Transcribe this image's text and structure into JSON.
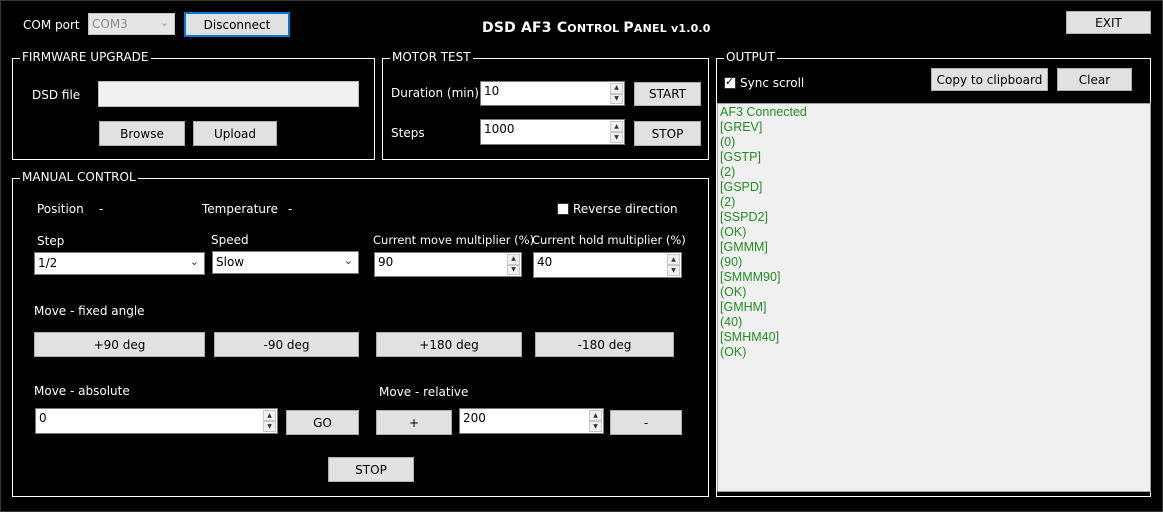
{
  "window": {
    "title_parts": [
      "DSD ",
      "AF3 C",
      "ONTROL ",
      "P",
      "ANEL ",
      "v1.0.0"
    ],
    "title": "DSD AF3 Control Panel v1.0.0",
    "exit_label": "EXIT"
  },
  "com": {
    "label": "COM port",
    "selected": "COM3",
    "disconnect_label": "Disconnect"
  },
  "firmware": {
    "legend": "FIRMWARE UPGRADE",
    "file_label": "DSD file",
    "file_value": "",
    "browse_label": "Browse",
    "upload_label": "Upload"
  },
  "motor_test": {
    "legend": "MOTOR TEST",
    "duration_label": "Duration (min)",
    "duration_value": "10",
    "steps_label": "Steps",
    "steps_value": "1000",
    "start_label": "START",
    "stop_label": "STOP"
  },
  "manual": {
    "legend": "MANUAL CONTROL",
    "position_label": "Position",
    "position_value": "-",
    "temperature_label": "Temperature",
    "temperature_value": "-",
    "reverse_label": "Reverse direction",
    "reverse_checked": false,
    "step_label": "Step",
    "step_value": "1/2",
    "speed_label": "Speed",
    "speed_value": "Slow",
    "move_mult_label": "Current move multiplier (%)",
    "move_mult_value": "90",
    "hold_mult_label": "Current hold multiplier (%)",
    "hold_mult_value": "40",
    "fixed_label": "Move - fixed angle",
    "fixed_buttons": [
      "+90 deg",
      "-90  deg",
      "+180  deg",
      "-180 deg"
    ],
    "absolute_label": "Move - absolute",
    "absolute_value": "0",
    "go_label": "GO",
    "relative_label": "Move - relative",
    "plus_label": "+",
    "relative_value": "200",
    "minus_label": "-",
    "stop_label": "STOP"
  },
  "output": {
    "legend": "OUTPUT",
    "sync_label": "Sync scroll",
    "sync_checked": true,
    "copy_label": "Copy to clipboard",
    "clear_label": "Clear",
    "lines": [
      "AF3 Connected",
      "[GREV]",
      "(0)",
      "[GSTP]",
      "(2)",
      "[GSPD]",
      "(2)",
      "[SSPD2]",
      "(OK)",
      "[GMMM]",
      "(90)",
      "[SMMM90]",
      "(OK)",
      "[GMHM]",
      "(40)",
      "[SMHM40]",
      "(OK)"
    ],
    "text_color": "#228b22"
  },
  "icons": {
    "dropdown": "chevron-down-icon",
    "spin_up": "spin-up-icon",
    "spin_down": "spin-down-icon",
    "checkmark": "checkmark-icon"
  }
}
